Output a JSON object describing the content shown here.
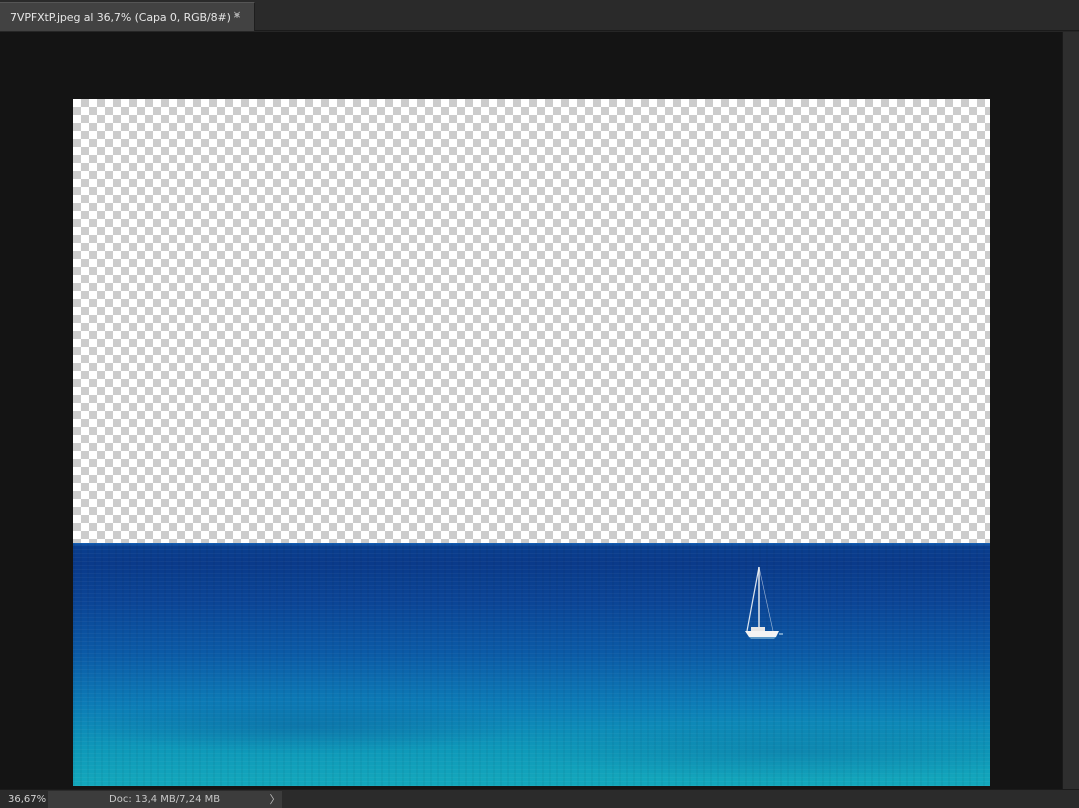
{
  "document_tab": {
    "title": "7VPFXtP.jpeg al 36,7% (Capa 0, RGB/8#) *",
    "close_icon": "close-icon",
    "close_glyph": "×"
  },
  "canvas": {
    "background_color": "#141414",
    "transparency": "checkerboard",
    "sea_colors": [
      "#0a3f8f",
      "#0b5aa6",
      "#13a8bc"
    ]
  },
  "status_bar": {
    "zoom": "36,67%",
    "doc_info": "Doc: 13,4 MB/7,24 MB",
    "arrow_glyph": "〉"
  }
}
